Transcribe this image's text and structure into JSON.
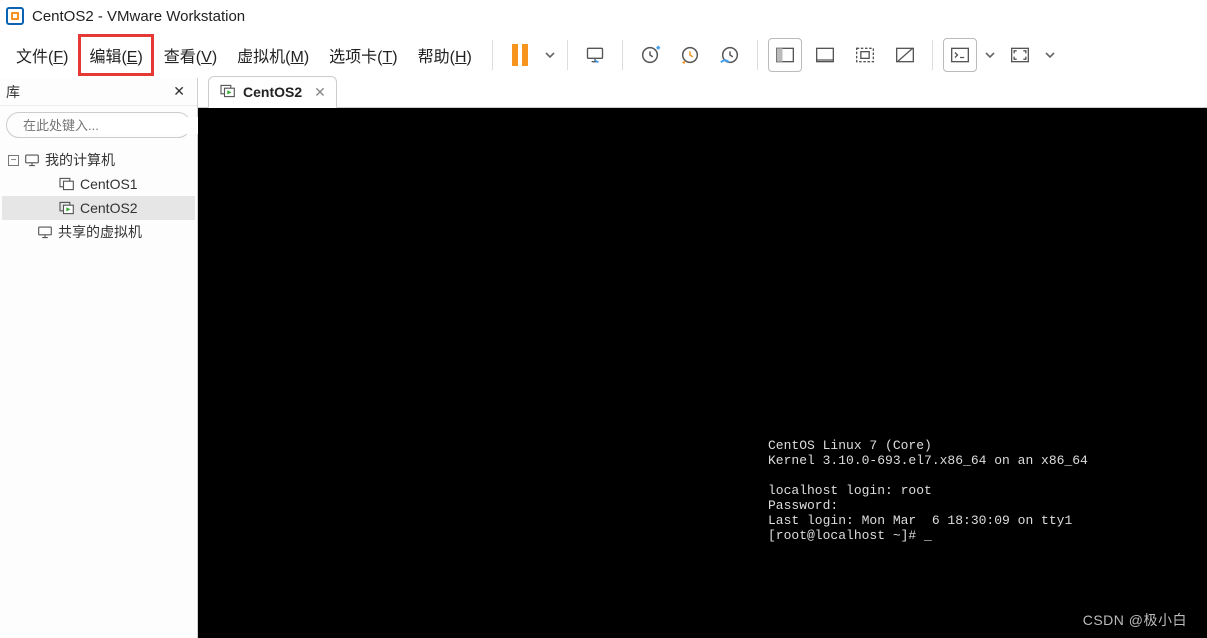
{
  "window": {
    "title": "CentOS2 - VMware Workstation"
  },
  "menu": {
    "file": {
      "label": "文件(",
      "key": "F",
      "tail": ")"
    },
    "edit": {
      "label": "编辑(",
      "key": "E",
      "tail": ")"
    },
    "view": {
      "label": "查看(",
      "key": "V",
      "tail": ")"
    },
    "vm": {
      "label": "虚拟机(",
      "key": "M",
      "tail": ")"
    },
    "tabs": {
      "label": "选项卡(",
      "key": "T",
      "tail": ")"
    },
    "help": {
      "label": "帮助(",
      "key": "H",
      "tail": ")"
    }
  },
  "sidebar": {
    "title": "库",
    "search_placeholder": "在此处键入...",
    "tree": {
      "root": "我的计算机",
      "items": [
        "CentOS1",
        "CentOS2"
      ],
      "shared": "共享的虚拟机"
    }
  },
  "tabs": {
    "active": "CentOS2"
  },
  "terminal": {
    "lines": [
      "CentOS Linux 7 (Core)",
      "Kernel 3.10.0-693.el7.x86_64 on an x86_64",
      "",
      "localhost login: root",
      "Password:",
      "Last login: Mon Mar  6 18:30:09 on tty1",
      "[root@localhost ~]# _"
    ]
  },
  "watermark": "CSDN @极小白"
}
